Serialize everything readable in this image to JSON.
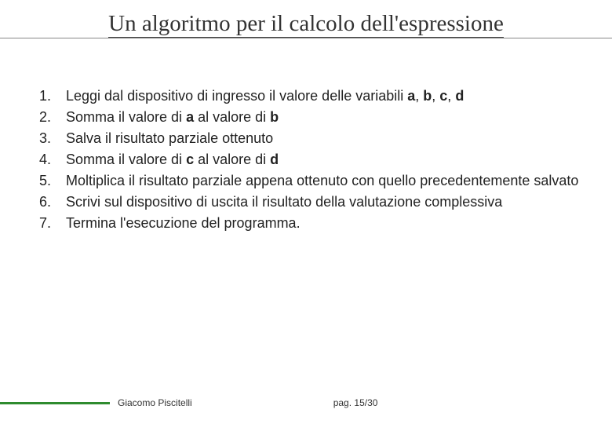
{
  "title": "Un algoritmo per il calcolo dell'espressione",
  "items": [
    {
      "n": "1.",
      "html": "Leggi dal dispositivo di ingresso il valore delle variabili <span class='b'>a</span>, <span class='b'>b</span>, <span class='b'>c</span>, <span class='b'>d</span>"
    },
    {
      "n": "2.",
      "html": "Somma il valore di <span class='b'>a</span> al valore di <span class='b'>b</span>"
    },
    {
      "n": "3.",
      "html": "Salva il risultato parziale ottenuto"
    },
    {
      "n": "4.",
      "html": "Somma il valore di <span class='b'>c</span> al valore di <span class='b'>d</span>"
    },
    {
      "n": "5.",
      "html": "Moltiplica il risultato parziale appena ottenuto con quello precedentemente salvato"
    },
    {
      "n": "6.",
      "html": "Scrivi sul dispositivo di uscita il risultato della valutazione complessiva"
    },
    {
      "n": "7.",
      "html": "Termina l'esecuzione del programma."
    }
  ],
  "footer": {
    "author": "Giacomo Piscitelli",
    "page": "pag. 15/30"
  }
}
